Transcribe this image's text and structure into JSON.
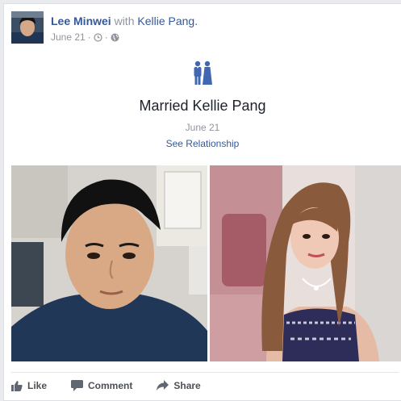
{
  "post": {
    "author": "Lee Minwei",
    "with_text": "with",
    "tagged_user": "Kellie Pang.",
    "date": "June 21",
    "separator": "·",
    "clock_icon": "clock-icon",
    "audience_icon": "globe-icon"
  },
  "life_event": {
    "icon": "couple-icon",
    "title": "Married Kellie Pang",
    "date": "June 21",
    "link": "See Relationship"
  },
  "actions": {
    "like": "Like",
    "comment": "Comment",
    "share": "Share"
  },
  "colors": {
    "link_blue": "#365899",
    "icon_blue": "#4267b2",
    "text_dark": "#1d2129",
    "text_muted": "#90949c"
  }
}
